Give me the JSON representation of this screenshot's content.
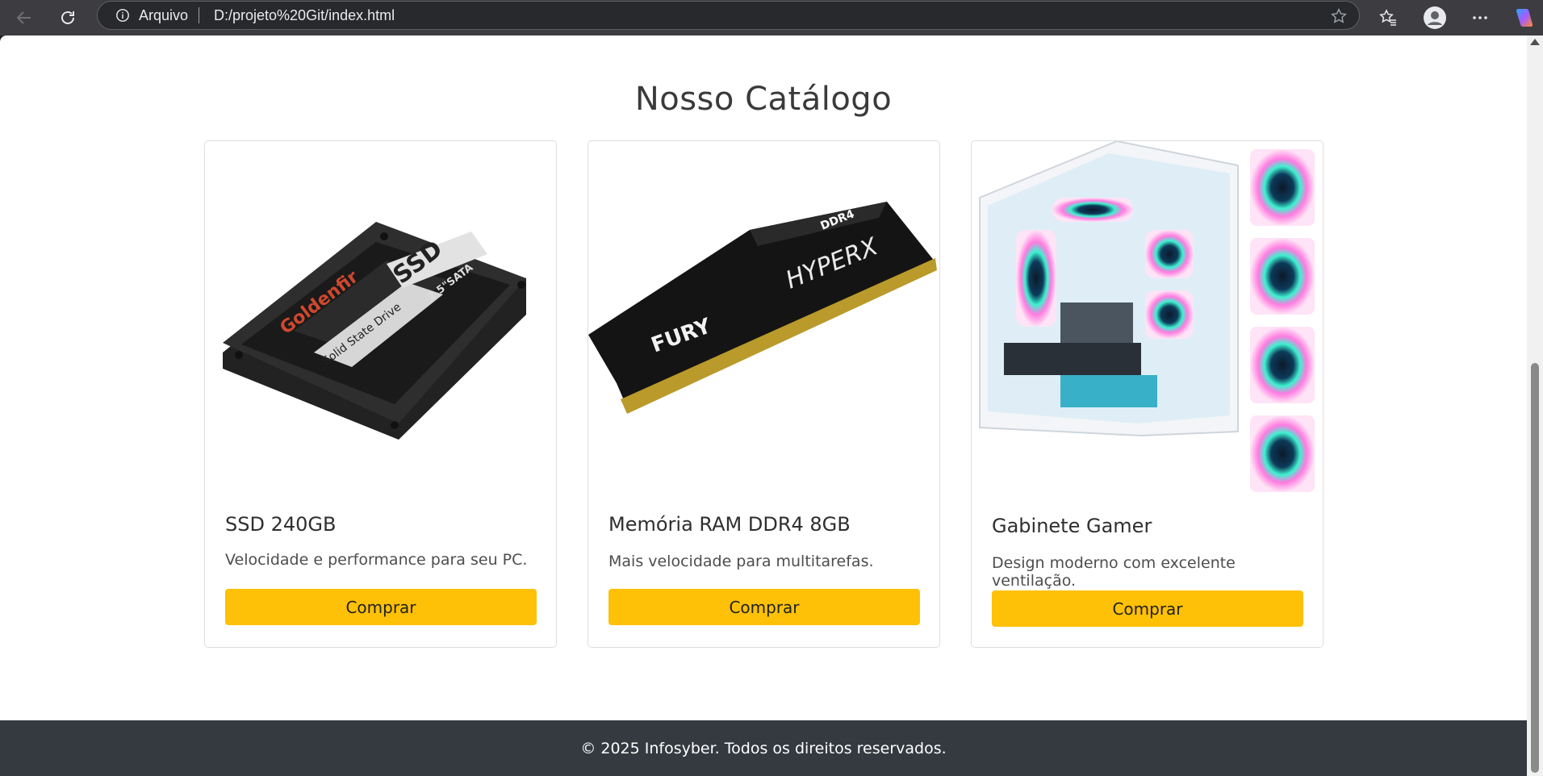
{
  "browser": {
    "origin_label": "Arquivo",
    "url": "D:/projeto%20Git/index.html",
    "icons": [
      "back-icon",
      "reload-icon",
      "info-icon",
      "star-icon",
      "favorites-icon",
      "profile-icon",
      "more-icon",
      "copilot-icon"
    ]
  },
  "page": {
    "title": "Nosso Catálogo",
    "products": [
      {
        "name": "SSD 240GB",
        "description": "Velocidade e performance para seu PC.",
        "button": "Comprar",
        "image_label_brand": "Goldenfir",
        "image_label_type": "Solid State Drive",
        "image_label_ssd": "SSD",
        "image_label_size": "2.5\"SATA"
      },
      {
        "name": "Memória RAM DDR4 8GB",
        "description": "Mais velocidade para multitarefas.",
        "button": "Comprar",
        "image_label_fury": "FURY",
        "image_label_hyperx": "HYPERX",
        "image_label_ddr": "DDR4"
      },
      {
        "name": "Gabinete Gamer",
        "description": "Design moderno com excelente ventilação.",
        "button": "Comprar"
      }
    ],
    "footer": "© 2025 Infosyber. Todos os direitos reservados."
  },
  "colors": {
    "accent_button": "#ffc107",
    "footer_bg": "#343a40",
    "chrome_bg": "#3c3c41"
  }
}
